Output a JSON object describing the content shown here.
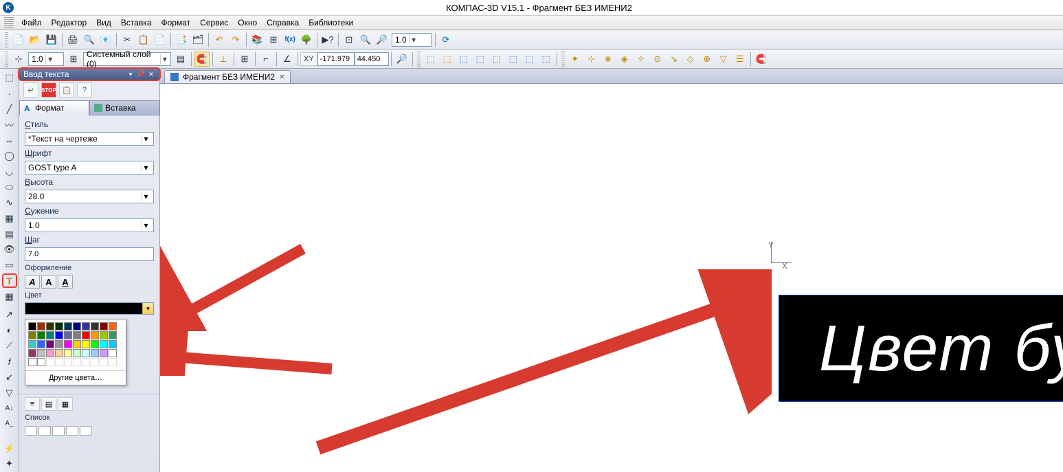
{
  "window": {
    "title": "КОМПАС-3D V15.1 - Фрагмент БЕЗ ИМЕНИ2",
    "app_icon_letter": "K"
  },
  "menu": {
    "items": [
      "Файл",
      "Редактор",
      "Вид",
      "Вставка",
      "Формат",
      "Сервис",
      "Окно",
      "Справка",
      "Библиотеки"
    ]
  },
  "toolbar1": {
    "zoom_combo": "1.0"
  },
  "toolbar2": {
    "scale_combo": "1.0",
    "layer_combo": "Системный слой (0)",
    "coord_x": "-171.979",
    "coord_y": "44.450",
    "xy_label": "XY"
  },
  "panel": {
    "title": "Ввод текста",
    "tabs": {
      "format": "Формат",
      "insert": "Вставка",
      "format_icon_letter": "A"
    },
    "labels": {
      "style": "Стиль",
      "font": "Шрифт",
      "height": "Высота",
      "narrow": "Сужение",
      "step": "Шаг",
      "decor": "Оформление",
      "color": "Цвет"
    },
    "ul": {
      "style": "С",
      "font": "Ш",
      "height": "В",
      "narrow": "С",
      "step": "Ш"
    },
    "values": {
      "style": "*Текст на чертеже",
      "font": "GOST type A",
      "height": "28.0",
      "narrow": "1.0",
      "step": "7.0"
    },
    "style_btns": {
      "italic": "A",
      "bold": "A",
      "underline": "A"
    },
    "more_colors": "Другие цвета…",
    "list_label": "Список"
  },
  "doc_tab": {
    "label": "Фрагмент БЕЗ ИМЕНИ2"
  },
  "canvas_text": "Цвет букв",
  "axis": {
    "x": "X",
    "y": "Y"
  },
  "color_grid": [
    [
      "#000000",
      "#993300",
      "#333300",
      "#003300",
      "#003366",
      "#000080",
      "#333399",
      "#333333",
      "#800000",
      "#ff6600"
    ],
    [
      "#808000",
      "#008000",
      "#008080",
      "#0000ff",
      "#666699",
      "#808080",
      "#ff0000",
      "#ff9900",
      "#99cc00",
      "#339966"
    ],
    [
      "#33cccc",
      "#3366ff",
      "#800080",
      "#969696",
      "#ff00ff",
      "#ffcc00",
      "#ffff00",
      "#00ff00",
      "#00ffff",
      "#00ccff"
    ],
    [
      "#993366",
      "#c0c0c0",
      "#ff99cc",
      "#ffcc99",
      "#ffff99",
      "#ccffcc",
      "#ccffff",
      "#99ccff",
      "#cc99ff",
      "#ffffff"
    ],
    [
      "#ffffff",
      "#ffffff",
      "",
      "",
      "",
      "",
      "",
      "",
      "",
      ""
    ]
  ]
}
